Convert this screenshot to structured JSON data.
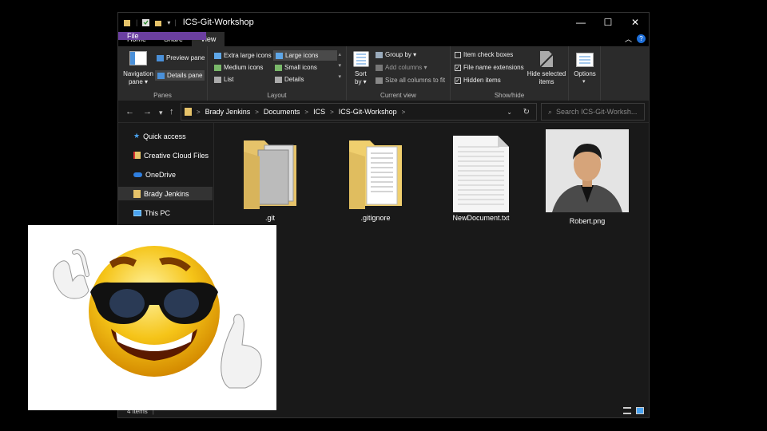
{
  "window": {
    "title": "ICS-Git-Workshop",
    "controls": {
      "minimize": "—",
      "maximize": "☐",
      "close": "✕"
    }
  },
  "tabs": [
    "File",
    "Home",
    "Share",
    "View"
  ],
  "ribbon": {
    "panes": {
      "group_label": "Panes",
      "navigation_pane": "Navigation",
      "navigation_pane_2": "pane ▾",
      "preview_pane": "Preview pane",
      "details_pane": "Details pane"
    },
    "layout": {
      "group_label": "Layout",
      "items": [
        "Extra large icons",
        "Large icons",
        "Medium icons",
        "Small icons",
        "List",
        "Details"
      ]
    },
    "current_view": {
      "group_label": "Current view",
      "sort_by_1": "Sort",
      "sort_by_2": "by ▾",
      "group_by": "Group by ▾",
      "add_columns": "Add columns ▾",
      "size_columns": "Size all columns to fit"
    },
    "show_hide": {
      "group_label": "Show/hide",
      "item_check_boxes": "Item check boxes",
      "file_name_extensions": "File name extensions",
      "hidden_items": "Hidden items",
      "hide_selected_1": "Hide selected",
      "hide_selected_2": "items"
    },
    "options": "Options"
  },
  "address": {
    "breadcrumbs": [
      "Brady Jenkins",
      "Documents",
      "ICS",
      "ICS-Git-Workshop"
    ],
    "search_placeholder": "Search ICS-Git-Worksh..."
  },
  "sidebar": {
    "items": [
      {
        "label": "Quick access"
      },
      {
        "label": "Creative Cloud Files"
      },
      {
        "label": "OneDrive"
      },
      {
        "label": "Brady Jenkins"
      },
      {
        "label": "This PC"
      }
    ]
  },
  "files": [
    {
      "name": ".git",
      "type": "folder"
    },
    {
      "name": ".gitignore",
      "type": "folder-doc"
    },
    {
      "name": "NewDocument.txt",
      "type": "text"
    },
    {
      "name": "Robert.png",
      "type": "image"
    }
  ],
  "status": {
    "count": "4 items"
  },
  "colors": {
    "accent_file_tab": "#6b3fa0",
    "folder": "#e6c36a",
    "window_bg": "#191919"
  }
}
